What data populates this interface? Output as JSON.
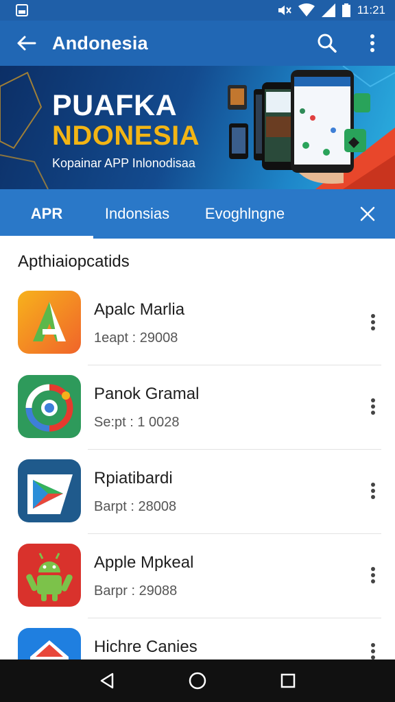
{
  "status_bar": {
    "time": "11:21"
  },
  "app_bar": {
    "title": "Andonesia"
  },
  "banner": {
    "line1": "PUAFKA",
    "line2": "NDONESIA",
    "tagline": "Kopainar APP Inlonodisaa"
  },
  "tabs": [
    {
      "label": "APR",
      "active": true
    },
    {
      "label": "Indonsias",
      "active": false
    },
    {
      "label": "Evoghlngne",
      "active": false
    }
  ],
  "section": {
    "title": "Apthiaiopcatids"
  },
  "apps": [
    {
      "name": "Apalc Marlia",
      "meta": "1eapt : 29008",
      "icon": "a-logo-icon"
    },
    {
      "name": "Panok Gramal",
      "meta": "Se:pt : 1 0028",
      "icon": "swirl-logo-icon"
    },
    {
      "name": "Rpiatibardi",
      "meta": "Barpt : 28008",
      "icon": "play-logo-icon"
    },
    {
      "name": "Apple Mpkeal",
      "meta": "Barpr : 29088",
      "icon": "android-logo-icon"
    },
    {
      "name": "Hichre Canies",
      "meta": "",
      "icon": "home-logo-icon"
    }
  ],
  "colors": {
    "app_bar": "#2167b4",
    "tabs": "#2a78c8",
    "status_bar": "#1f5fa8",
    "accent_yellow": "#f2b515"
  }
}
